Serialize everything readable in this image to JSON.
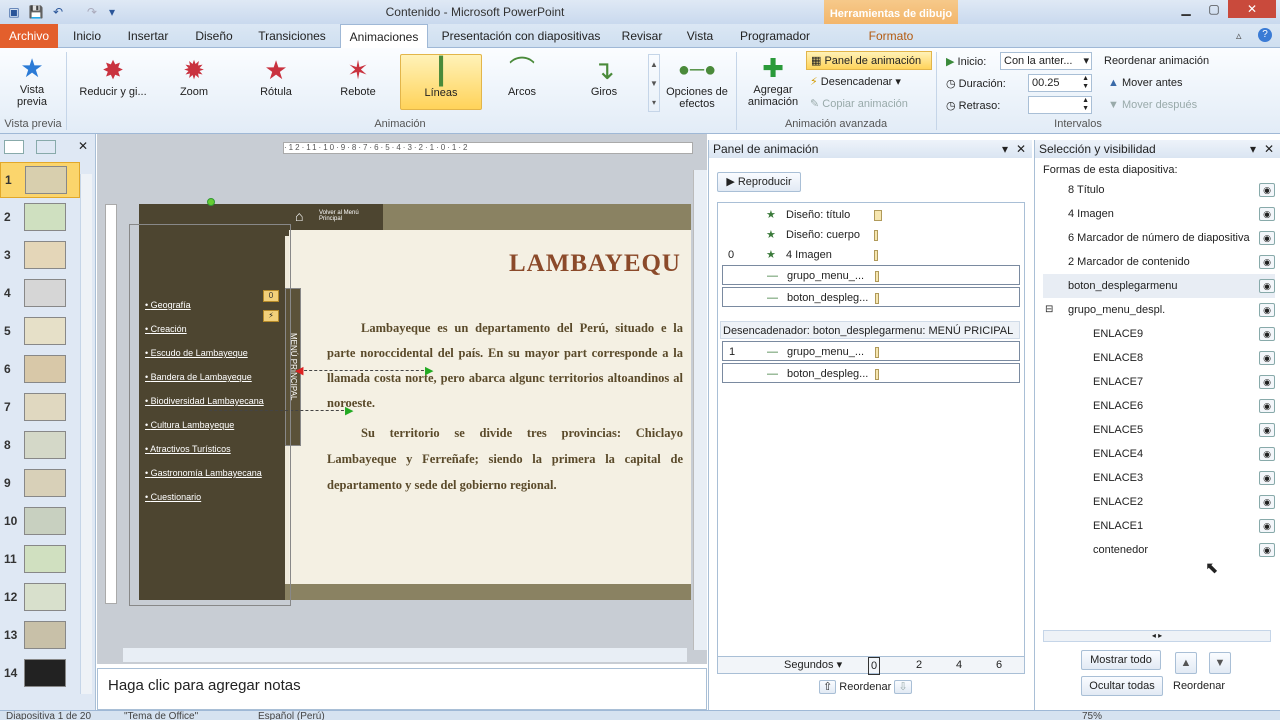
{
  "window": {
    "title": "Contenido  -  Microsoft PowerPoint",
    "context_tab_group": "Herramientas de dibujo"
  },
  "tabs": [
    "Archivo",
    "Inicio",
    "Insertar",
    "Diseño",
    "Transiciones",
    "Animaciones",
    "Presentación con diapositivas",
    "Revisar",
    "Vista",
    "Programador",
    "Formato"
  ],
  "ribbon": {
    "vista_previa": "Vista previa",
    "vista_previa_group": "Vista previa",
    "effects": [
      "Reducir y gi...",
      "Zoom",
      "Rótula",
      "Rebote",
      "Líneas",
      "Arcos",
      "Giros"
    ],
    "opciones_efectos": "Opciones de efectos",
    "animacion_group": "Animación",
    "agregar_animacion": "Agregar animación",
    "panel_animacion": "Panel de animación",
    "desencadenar": "Desencadenar",
    "copiar_animacion": "Copiar animación",
    "animacion_avanzada_group": "Animación avanzada",
    "inicio_label": "Inicio:",
    "inicio_value": "Con la anter...",
    "duracion_label": "Duración:",
    "duracion_value": "00.25",
    "retraso_label": "Retraso:",
    "retraso_value": "",
    "reordenar": "Reordenar animación",
    "mover_antes": "Mover antes",
    "mover_despues": "Mover después",
    "intervalos_group": "Intervalos"
  },
  "thumbnails": [
    "1",
    "2",
    "3",
    "4",
    "5",
    "6",
    "7",
    "8",
    "9",
    "10",
    "11",
    "12",
    "13",
    "14"
  ],
  "slide": {
    "home_link": "Volver al Menú Principal",
    "title": "LAMBAYEQU",
    "menu_items": [
      "Geografía",
      "Creación",
      "Escudo de Lambayeque",
      "Bandera de Lambayeque",
      "Biodiversidad Lambayecana",
      "Cultura Lambayeque",
      "Atractivos Turísticos",
      "Gastronomía Lambayecana",
      "Cuestionario"
    ],
    "menu_vertical": "MENÚ PRINCIPAL",
    "tag0": "0",
    "para1": "Lambayeque es un departamento del Perú, situado e la parte noroccidental del país. En su mayor part corresponde a la llamada costa norte, pero abarca algunc territorios altoandinos al noroeste.",
    "para2": "Su territorio se divide tres provincias: Chiclayo Lambayeque y Ferreñafe; siendo la primera la capital de departamento y sede del gobierno regional."
  },
  "notes": "Haga clic para agregar notas",
  "anim_panel": {
    "title": "Panel de animación",
    "play": "Reproducir",
    "rows": [
      {
        "num": "",
        "label": "Diseño: título"
      },
      {
        "num": "",
        "label": "Diseño: cuerpo"
      },
      {
        "num": "0",
        "label": "4 Imagen"
      },
      {
        "num": "",
        "label": "grupo_menu_..."
      },
      {
        "num": "",
        "label": "boton_despleg..."
      }
    ],
    "trigger": "Desencadenador: boton_desplegarmenu: MENÚ PRICIPAL",
    "trigger_rows": [
      {
        "num": "1",
        "label": "grupo_menu_..."
      },
      {
        "num": "",
        "label": "boton_despleg..."
      }
    ],
    "segundos": "Segundos",
    "timeline": [
      "0",
      "2",
      "4",
      "6"
    ],
    "reordenar": "Reordenar"
  },
  "sel_panel": {
    "title": "Selección y visibilidad",
    "subtitle": "Formas de esta diapositiva:",
    "items": [
      {
        "label": "8 Título",
        "indent": 0
      },
      {
        "label": "4 Imagen",
        "indent": 0
      },
      {
        "label": "6 Marcador de número de diapositiva",
        "indent": 0
      },
      {
        "label": "2 Marcador de contenido",
        "indent": 0
      },
      {
        "label": "boton_desplegarmenu",
        "indent": 0
      },
      {
        "label": "grupo_menu_despl.",
        "indent": 0
      },
      {
        "label": "ENLACE9",
        "indent": 1
      },
      {
        "label": "ENLACE8",
        "indent": 1
      },
      {
        "label": "ENLACE7",
        "indent": 1
      },
      {
        "label": "ENLACE6",
        "indent": 1
      },
      {
        "label": "ENLACE5",
        "indent": 1
      },
      {
        "label": "ENLACE4",
        "indent": 1
      },
      {
        "label": "ENLACE3",
        "indent": 1
      },
      {
        "label": "ENLACE2",
        "indent": 1
      },
      {
        "label": "ENLACE1",
        "indent": 1
      },
      {
        "label": "contenedor",
        "indent": 1
      }
    ],
    "mostrar_todo": "Mostrar todo",
    "ocultar_todas": "Ocultar todas",
    "reordenar": "Reordenar"
  },
  "status": {
    "slide": "Diapositiva 1 de 20",
    "theme": "\"Tema de Office\"",
    "lang": "Español (Perú)",
    "zoom": "75%"
  }
}
